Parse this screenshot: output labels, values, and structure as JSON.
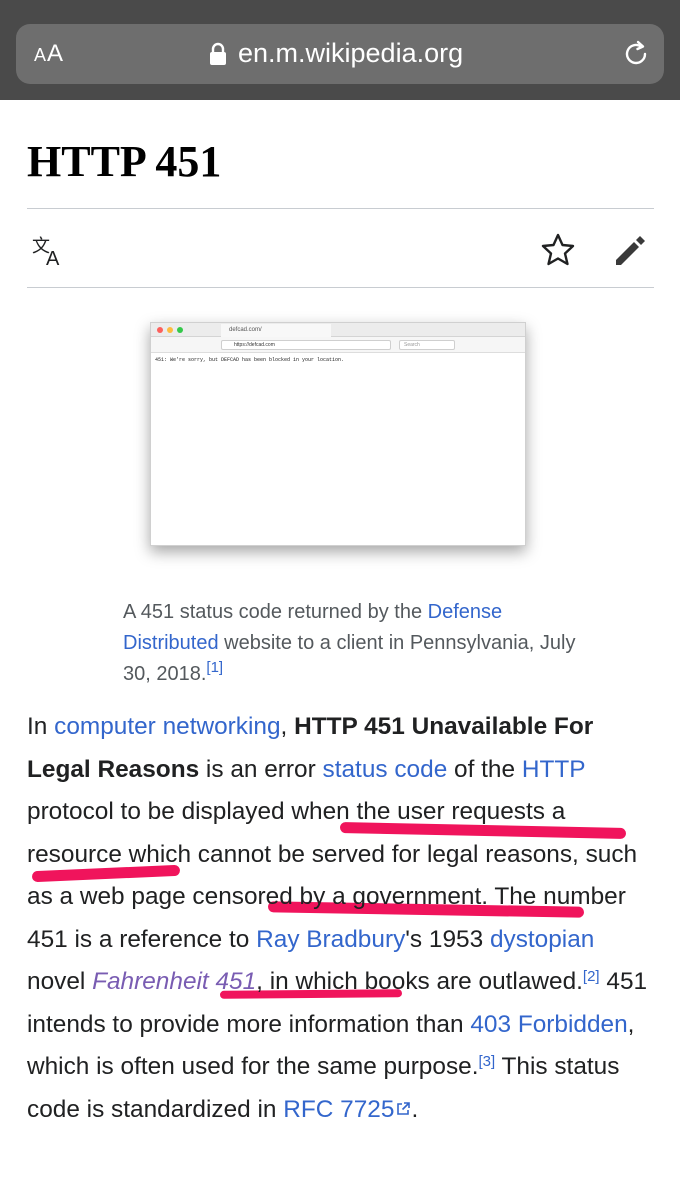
{
  "browser": {
    "aa_small": "A",
    "aa_large": "A",
    "url": "en.m.wikipedia.org"
  },
  "page": {
    "title": "HTTP 451"
  },
  "figure": {
    "tab_label": "defcad.com/",
    "url": "https://defcad.com",
    "search_placeholder": "Search",
    "message": "451: We're sorry, but DEFCAD has been blocked in your location.",
    "caption": {
      "part1": "A 451 status code returned by the ",
      "link": "Defense Distributed",
      "part2": " website to a client in Pennsylvania, July 30, 2018.",
      "ref": "[1]"
    }
  },
  "article": {
    "t1": "In ",
    "l_networking": "computer networking",
    "t2": ", ",
    "bold": "HTTP 451 Unavailable For Legal Reasons",
    "t3": " is an error ",
    "l_status": "status code",
    "t4": " of the ",
    "l_http": "HTTP",
    "t5": " protocol to be displayed when the user requests a resource which cannot be served for legal reasons, such as a web page censored by a government. The number 451 is a reference to ",
    "l_bradbury": "Ray Bradbury",
    "t6": "'s 1953 ",
    "l_dystopian": "dystopian",
    "t7": " novel ",
    "l_fahrenheit": "Fahrenheit 451",
    "t8": ", in which books are outlawed.",
    "ref2": "[2]",
    "t9": " 451 intends to provide more information than ",
    "l_403": "403 Forbidden",
    "t10": ", which is often used for the same purpose.",
    "ref3": "[3]",
    "t11": " This status code is standardized in ",
    "l_rfc": "RFC 7725",
    "t12": "."
  },
  "colors": {
    "link": "#3366cc",
    "visited_link": "#795cb2",
    "marker": "#f0145c",
    "browser_bar": "#4a4a4a"
  }
}
